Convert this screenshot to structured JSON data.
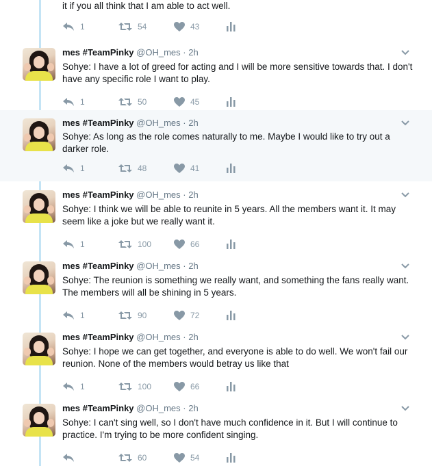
{
  "tweets": [
    {
      "text": "it if you all think that I am able to act well.",
      "replies": "1",
      "retweets": "54",
      "likes": "43"
    },
    {
      "name": "mes #TeamPinky",
      "handle": "@OH_mes · 2h",
      "text": "Sohye: I have a lot of greed for acting and I will be more sensitive towards that. I don't have any specific role I want to play.",
      "replies": "1",
      "retweets": "50",
      "likes": "45"
    },
    {
      "name": "mes #TeamPinky",
      "handle": "@OH_mes · 2h",
      "text": "Sohye: As long as the role comes naturally to me. Maybe I would like to try out a darker role.",
      "replies": "1",
      "retweets": "48",
      "likes": "41"
    },
    {
      "name": "mes #TeamPinky",
      "handle": "@OH_mes · 2h",
      "text": "Sohye: I think we will be able to reunite in 5 years. All the members want it. It may seem like a joke but we really want it.",
      "replies": "1",
      "retweets": "100",
      "likes": "66"
    },
    {
      "name": "mes #TeamPinky",
      "handle": "@OH_mes · 2h",
      "text": "Sohye: The reunion is something we really want, and something the fans really want. The members will all be shining in 5 years.",
      "replies": "1",
      "retweets": "90",
      "likes": "72"
    },
    {
      "name": "mes #TeamPinky",
      "handle": "@OH_mes · 2h",
      "text": "Sohye: I hope we can get together, and everyone is able to do well. We won't fail our reunion. None of the members would betray us like that",
      "replies": "1",
      "retweets": "100",
      "likes": "66"
    },
    {
      "name": "mes #TeamPinky",
      "handle": "@OH_mes · 2h",
      "text": "Sohye: I can't sing well, so I don't have much confidence in it. But I will continue to practice. I'm trying to be more confident singing.",
      "replies": "",
      "retweets": "60",
      "likes": "54"
    }
  ],
  "icons": {
    "reply": "reply-icon",
    "retweet": "retweet-icon",
    "like": "heart-icon",
    "analytics": "analytics-icon",
    "caret": "chevron-down-icon"
  },
  "colors": {
    "thread_line": "#c4e4f5",
    "highlight_bg": "#f5f8fa",
    "action_gray": "#8899a6",
    "handle_gray": "#657786"
  }
}
